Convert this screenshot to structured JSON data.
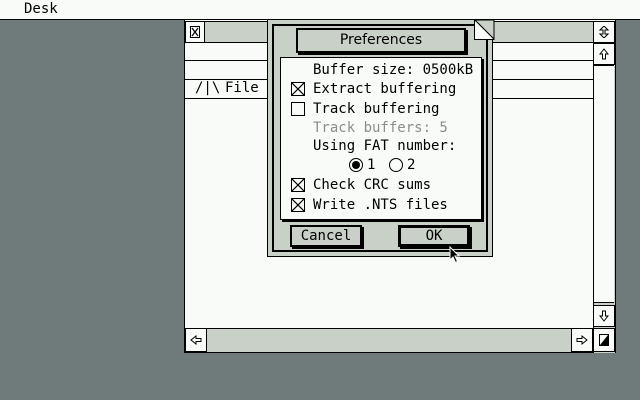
{
  "menubar": {
    "desk": "Desk"
  },
  "window": {
    "close_icon": "close-icon",
    "full_icon": "fullscreen-icon",
    "up_icon": "arrow-up-icon",
    "down_icon": "arrow-down-icon",
    "left_icon": "arrow-left-icon",
    "right_icon": "arrow-right-icon",
    "inner_menu": {
      "logo": "/|\\",
      "file": "File"
    }
  },
  "dialog": {
    "title": "Preferences",
    "buffer_size": "Buffer size: 0500kB",
    "extract_buffering": {
      "label": "Extract buffering",
      "checked": true
    },
    "track_buffering": {
      "label": "Track buffering",
      "checked": false
    },
    "track_buffers": {
      "label": "Track buffers: 5",
      "disabled": true
    },
    "fat_label": "Using FAT number:",
    "fat_options": [
      {
        "label": "1",
        "selected": true
      },
      {
        "label": "2",
        "selected": false
      }
    ],
    "check_crc": {
      "label": "Check CRC sums",
      "checked": true
    },
    "write_nts": {
      "label": "Write .NTS files",
      "checked": true
    },
    "cancel": "Cancel",
    "ok": "OK"
  },
  "colors": {
    "desktop": "#6f7b7b",
    "window_gray": "#c8d0c8",
    "paper": "#f8fbf8"
  }
}
